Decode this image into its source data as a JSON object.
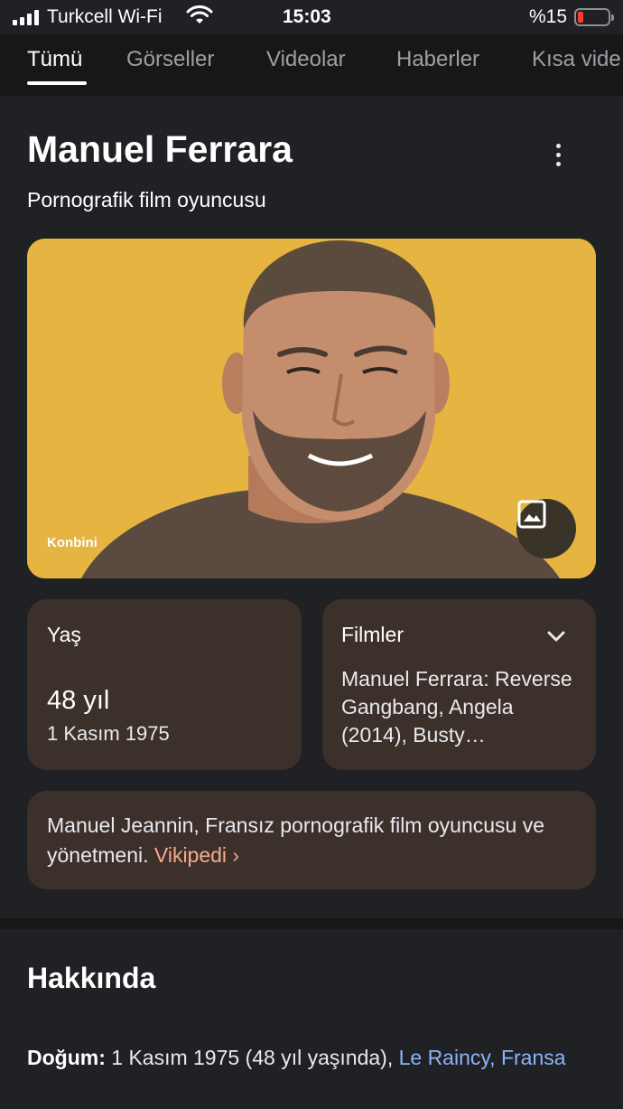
{
  "status_bar": {
    "carrier": "Turkcell Wi-Fi",
    "time": "15:03",
    "battery": "%15"
  },
  "tabs": [
    {
      "label": "Tümü",
      "active": true
    },
    {
      "label": "Görseller",
      "active": false
    },
    {
      "label": "Videolar",
      "active": false
    },
    {
      "label": "Haberler",
      "active": false
    },
    {
      "label": "Kısa vide",
      "active": false
    }
  ],
  "panel": {
    "title": "Manuel Ferrara",
    "subtitle": "Pornografik film oyuncusu",
    "photo_credit": "Konbini",
    "age_label": "Yaş",
    "age_value": "48 yıl",
    "age_date": "1 Kasım 1975",
    "films_label": "Filmler",
    "films_text": "Manuel Ferrara: Reverse Gangbang, Angela (2014), Busty…",
    "description": "Manuel Jeannin, Fransız pornografik film oyuncusu ve yönetmeni.",
    "wiki_link": "Vikipedi ›"
  },
  "about": {
    "title": "Hakkında",
    "birth_label": "Doğum:",
    "birth_value": "1 Kasım 1975 (48 yıl yaşında),",
    "birth_place": "Le Raincy, Fransa"
  },
  "colors": {
    "background": "#202124",
    "card": "#3c302b",
    "link_blue": "#8ab4f8",
    "link_orange": "#f6aa8f",
    "photo_background": "#e5b441"
  }
}
